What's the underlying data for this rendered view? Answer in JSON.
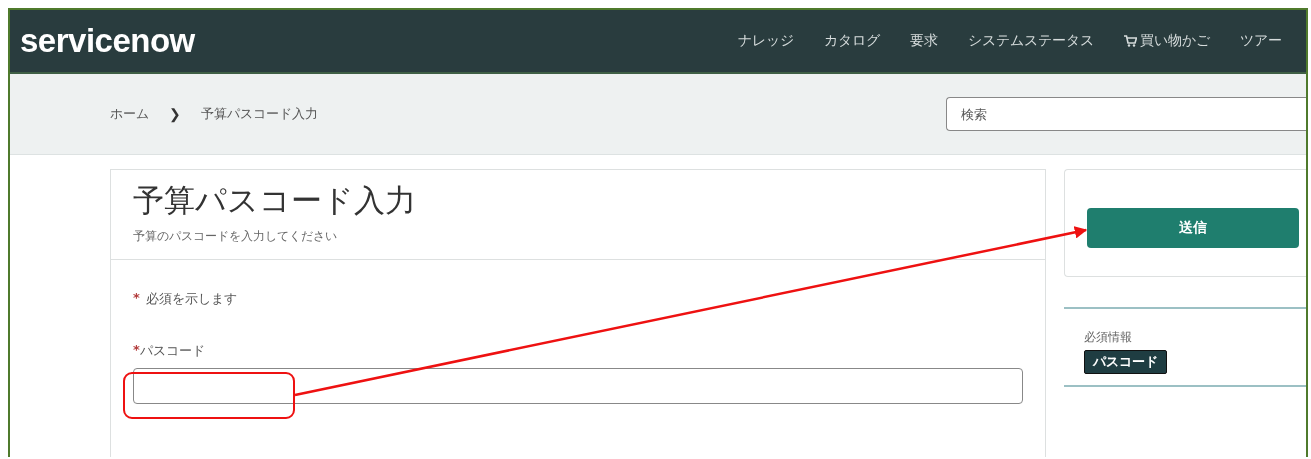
{
  "header": {
    "logo": "servicenow",
    "nav": [
      {
        "label": "ナレッジ",
        "kind": "link"
      },
      {
        "label": "カタログ",
        "kind": "link"
      },
      {
        "label": "要求",
        "kind": "link"
      },
      {
        "label": "システムステータス",
        "kind": "link"
      },
      {
        "label": "買い物かご",
        "kind": "cart"
      },
      {
        "label": "ツアー",
        "kind": "link"
      }
    ]
  },
  "breadcrumb": {
    "items": [
      "ホーム",
      "予算パスコード入力"
    ],
    "separator": "❯"
  },
  "search": {
    "placeholder": "検索"
  },
  "form": {
    "title": "予算パスコード入力",
    "subtitle": "予算のパスコードを入力してください",
    "required_mark": "*",
    "required_note": "必須を示します",
    "fields": [
      {
        "label": "パスコード",
        "required": true
      }
    ]
  },
  "sidebar": {
    "submit": "送信",
    "required_info_label": "必須情報",
    "required_tags": [
      "パスコード"
    ]
  },
  "annotation": {
    "highlight": true,
    "arrow": true
  }
}
